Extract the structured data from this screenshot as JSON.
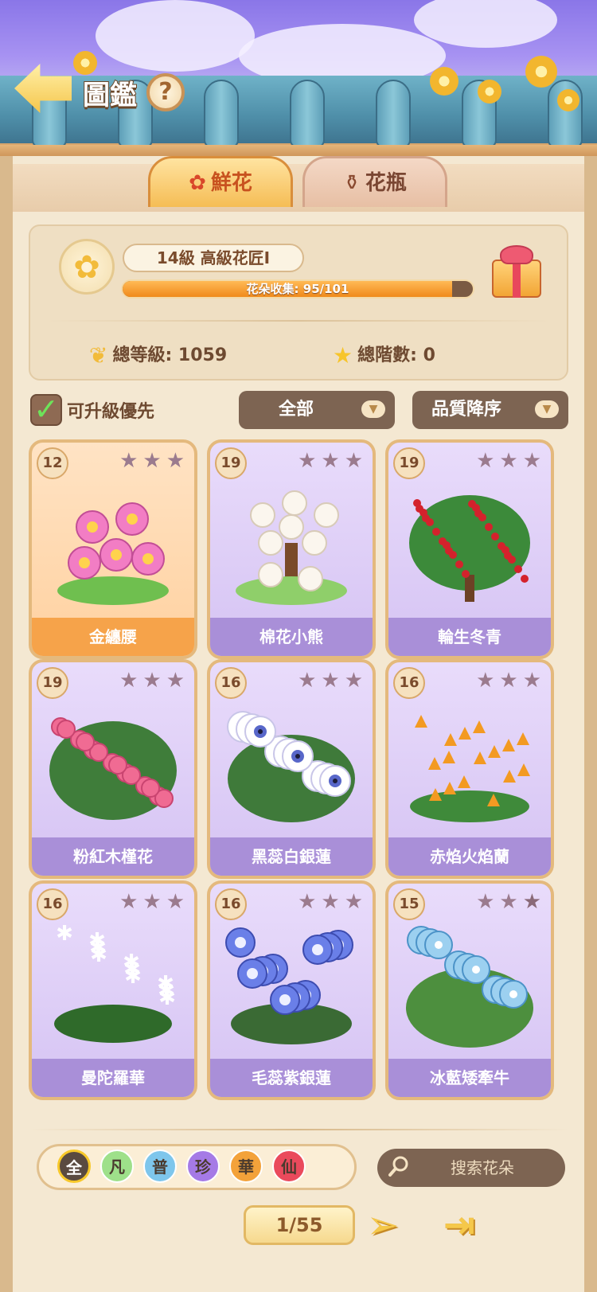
{
  "header": {
    "title": "圖鑑",
    "help_label": "?"
  },
  "tabs": [
    {
      "label": "鮮花",
      "icon": "rose-icon",
      "active": true
    },
    {
      "label": "花瓶",
      "icon": "vase-icon",
      "active": false
    }
  ],
  "profile": {
    "level_text": "14級  高級花匠Ⅰ",
    "progress_label": "花朵收集: 95/101",
    "progress_fraction": 0.9406,
    "total_level_label": "總等級: 1059",
    "total_stars_label": "總階數: 0"
  },
  "filters": {
    "upgrade_first_label": "可升級優先",
    "upgrade_first_checked": true,
    "category_selected": "全部",
    "sort_selected": "品質降序"
  },
  "cards": [
    {
      "level": "12",
      "name": "金纏腰",
      "stars_full": 0,
      "rarity": "gold",
      "art": "lotus"
    },
    {
      "level": "19",
      "name": "棉花小熊",
      "stars_full": 0,
      "rarity": "purple",
      "art": "cotton-bear-tree"
    },
    {
      "level": "19",
      "name": "輪生冬青",
      "stars_full": 0,
      "rarity": "purple",
      "art": "holly"
    },
    {
      "level": "19",
      "name": "粉紅木槿花",
      "stars_full": 0,
      "rarity": "purple",
      "art": "pink-hibiscus"
    },
    {
      "level": "16",
      "name": "黑蕊白銀蓮",
      "stars_full": 0,
      "rarity": "purple",
      "art": "white-anemone"
    },
    {
      "level": "16",
      "name": "赤焰火焰蘭",
      "stars_full": 0,
      "rarity": "purple",
      "art": "flame-orchid"
    },
    {
      "level": "16",
      "name": "曼陀羅華",
      "stars_full": 0,
      "rarity": "purple",
      "art": "white-lily"
    },
    {
      "level": "16",
      "name": "毛蕊紫銀蓮",
      "stars_full": 0,
      "rarity": "purple",
      "art": "blue-anemone"
    },
    {
      "level": "15",
      "name": "冰藍矮牽牛",
      "stars_full": 1,
      "rarity": "purple",
      "art": "blue-petunia"
    }
  ],
  "quality_filters": [
    {
      "label": "全",
      "color": "#5a4a40",
      "selected": true
    },
    {
      "label": "凡",
      "color": "#9ee08a",
      "selected": false
    },
    {
      "label": "普",
      "color": "#7ec6ec",
      "selected": false
    },
    {
      "label": "珍",
      "color": "#a57ae6",
      "selected": false
    },
    {
      "label": "華",
      "color": "#f3a23a",
      "selected": false
    },
    {
      "label": "仙",
      "color": "#ea4a5c",
      "selected": false
    }
  ],
  "search": {
    "placeholder": "搜索花朵"
  },
  "pagination": {
    "current": "1/55"
  },
  "colors": {
    "accent": "#f5bd55",
    "card_purple": "#a98fd8",
    "card_gold": "#f6a34a",
    "progress": "#f08a1c"
  }
}
